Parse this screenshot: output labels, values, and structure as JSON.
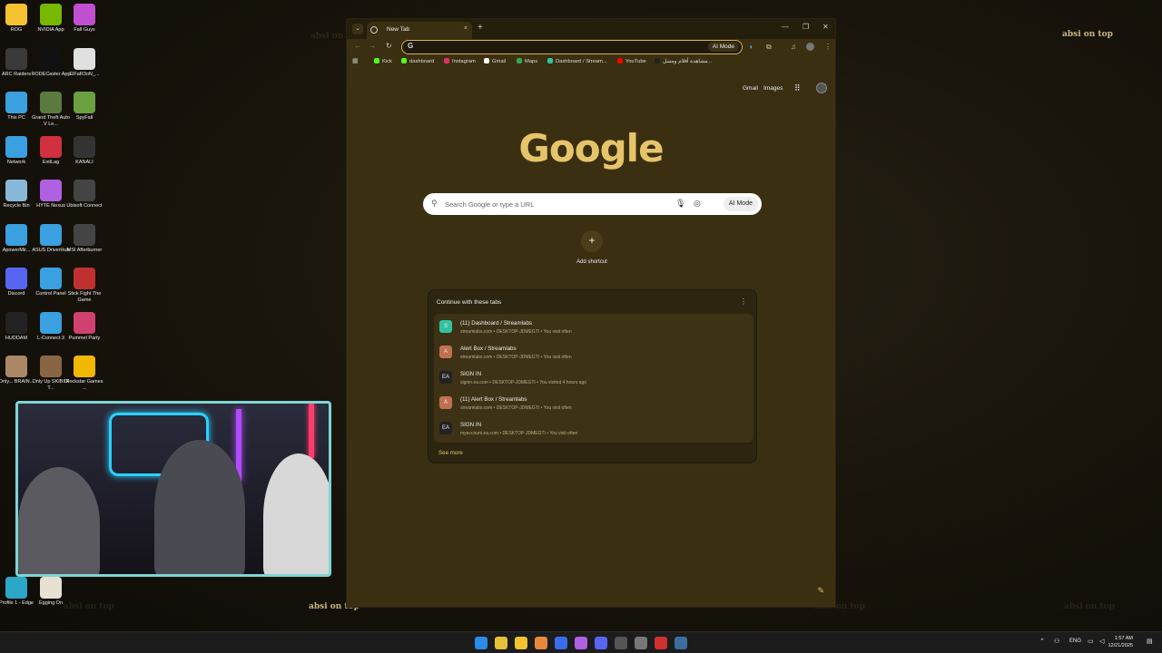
{
  "desktop": {
    "icons": [
      {
        "label": "ROG",
        "color": "#f2c230"
      },
      {
        "label": "NVIDIA App",
        "color": "#76b900"
      },
      {
        "label": "Fall Guys",
        "color": "#c04fd1"
      },
      {
        "label": "ARC Raiders",
        "color": "#3a3a3a"
      },
      {
        "label": "RODECaster App",
        "color": "#111111"
      },
      {
        "label": "ElFaR3oN_...",
        "color": "#e0e0e0"
      },
      {
        "label": "This PC",
        "color": "#3aa0e0"
      },
      {
        "label": "Grand Theft Auto V Le...",
        "color": "#5a7a40"
      },
      {
        "label": "SpyFall",
        "color": "#6aa040"
      },
      {
        "label": "Network",
        "color": "#3aa0e0"
      },
      {
        "label": "ExitLag",
        "color": "#d03040"
      },
      {
        "label": "KANALI",
        "color": "#333333"
      },
      {
        "label": "Recycle Bin",
        "color": "#8ab8d8"
      },
      {
        "label": "HYTE Nexus",
        "color": "#b060e0"
      },
      {
        "label": "Ubisoft Connect",
        "color": "#444444"
      },
      {
        "label": "ApowerMir...",
        "color": "#3aa0e0"
      },
      {
        "label": "ASUS DriverHub",
        "color": "#3aa0e0"
      },
      {
        "label": "MSI Afterburner",
        "color": "#444444"
      },
      {
        "label": "Discord",
        "color": "#5865f2"
      },
      {
        "label": "Control Panel",
        "color": "#3aa0e0"
      },
      {
        "label": "Stick Fight The Game",
        "color": "#c03030"
      },
      {
        "label": "HUDDAM",
        "color": "#222222"
      },
      {
        "label": "L-Connect 3",
        "color": "#3aa0e0"
      },
      {
        "label": "Pummel Party",
        "color": "#d04070"
      },
      {
        "label": "Only... BRAIN...",
        "color": "#aa8866"
      },
      {
        "label": "Only Up SKIBIDI T...",
        "color": "#886644"
      },
      {
        "label": "Rockstar Games ...",
        "color": "#f2b700"
      },
      {
        "label": "Profile 1 - Edge",
        "color": "#2ba7c9"
      },
      {
        "label": "Egging On",
        "color": "#e8e0d0"
      }
    ],
    "watermark": "absi on top"
  },
  "browser": {
    "tab_title": "New Tab",
    "tab_close": "×",
    "new_tab": "+",
    "tab_search_icon": "⌄",
    "window_minimize": "—",
    "window_maximize": "❐",
    "window_close": "✕",
    "nav": {
      "back": "←",
      "forward": "→",
      "reload": "↻"
    },
    "omnibox": {
      "g_glyph": "G",
      "value": "",
      "placeholder": "",
      "ai_mode": "AI Mode"
    },
    "toolbar_icons": {
      "extensions": "⧉",
      "media": "♫",
      "menu": "⋮"
    },
    "bookmarks": [
      {
        "label": "Kick",
        "color": "#53fc18"
      },
      {
        "label": "dashboard",
        "color": "#53fc18"
      },
      {
        "label": "Instagram",
        "color": "#e1306c"
      },
      {
        "label": "Gmail",
        "color": "#ffffff"
      },
      {
        "label": "Maps",
        "color": "#34a853"
      },
      {
        "label": "Dashboard / Stream...",
        "color": "#31c3a2"
      },
      {
        "label": "YouTube",
        "color": "#ff0000"
      },
      {
        "label": "مشاهدة أفلام ومسل...",
        "color": "#222222"
      }
    ],
    "ntp": {
      "gmail": "Gmail",
      "images": "Images",
      "logo": "Google",
      "search_placeholder": "Search Google or type a URL",
      "search_ai": "AI Mode",
      "add_shortcut": "Add shortcut",
      "add_shortcut_plus": "+",
      "continue_title": "Continue with these tabs",
      "continue_menu": "⋮",
      "tabs": [
        {
          "icon": "S",
          "icon_color": "#31c3a2",
          "title": "(11) Dashboard / Streamlabs",
          "meta": "streamlabs.com • DESKTOP-JDMEGTI • You visit often"
        },
        {
          "icon": "A",
          "icon_color": "#c07050",
          "title": "Alert Box / Streamlabs",
          "meta": "streamlabs.com • DESKTOP-JDMEGTI • You visit often"
        },
        {
          "icon": "EA",
          "icon_color": "#222222",
          "title": "SIGN IN",
          "meta": "signin.ea.com • DESKTOP-JDMEGTI • You visited 4 hours ago"
        },
        {
          "icon": "A",
          "icon_color": "#c07050",
          "title": "(11) Alert Box / Streamlabs",
          "meta": "streamlabs.com • DESKTOP-JDMEGTI • You visit often"
        },
        {
          "icon": "EA",
          "icon_color": "#222222",
          "title": "SIGN IN",
          "meta": "myaccount.ea.com • DESKTOP-JDMEGTI • You visit often"
        }
      ],
      "see_more": "See more",
      "edit_icon": "✎"
    }
  },
  "taskbar": {
    "apps": [
      {
        "name": "start",
        "color": "#2b8ce8"
      },
      {
        "name": "chrome",
        "color": "#e6c03a"
      },
      {
        "name": "file-explorer",
        "color": "#f2c230"
      },
      {
        "name": "app-orange",
        "color": "#e8893a"
      },
      {
        "name": "app-blue",
        "color": "#3a6ee8"
      },
      {
        "name": "app-hyte",
        "color": "#b060e0"
      },
      {
        "name": "discord",
        "color": "#5865f2"
      },
      {
        "name": "app-dark",
        "color": "#555555"
      },
      {
        "name": "app-gray",
        "color": "#777777"
      },
      {
        "name": "app-red",
        "color": "#d03030"
      },
      {
        "name": "steam",
        "color": "#3a6e9e"
      }
    ],
    "lang": "ENG",
    "time": "1:57 AM",
    "date": "12/21/2025"
  },
  "colors": {
    "accent": "#e6c56a",
    "window_bg": "#3b2f12",
    "webcam_border": "#7fd4d4"
  }
}
